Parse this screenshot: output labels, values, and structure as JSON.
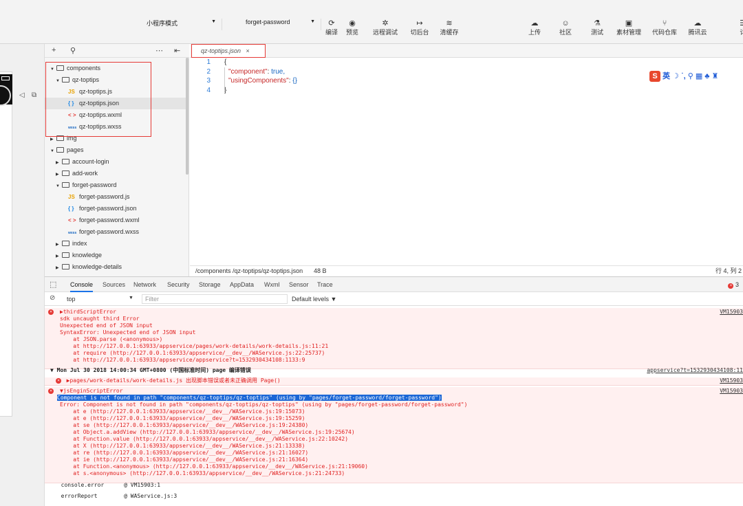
{
  "toolbar": {
    "mode_select": "小程序模式",
    "page_select": "forget-password",
    "buttons": [
      {
        "id": "compile",
        "icon": "refresh-icon",
        "glyph": "⟳",
        "label": "编译"
      },
      {
        "id": "preview",
        "icon": "eye-icon",
        "glyph": "◉",
        "label": "预览"
      },
      {
        "id": "remote-debug",
        "icon": "bug-icon",
        "glyph": "✲",
        "label": "远程调试"
      },
      {
        "id": "background",
        "icon": "switch-icon",
        "glyph": "↦",
        "label": "切后台"
      },
      {
        "id": "clear-cache",
        "icon": "layers-icon",
        "glyph": "≋",
        "label": "清缓存"
      },
      {
        "id": "upload",
        "icon": "cloud-upload-icon",
        "glyph": "☁",
        "label": "上传"
      },
      {
        "id": "community",
        "icon": "chat-icon",
        "glyph": "☺",
        "label": "社区"
      },
      {
        "id": "test",
        "icon": "flask-icon",
        "glyph": "⚗",
        "label": "测试"
      },
      {
        "id": "assets",
        "icon": "image-icon",
        "glyph": "▣",
        "label": "素材管理"
      },
      {
        "id": "repo",
        "icon": "branch-icon",
        "glyph": "⑂",
        "label": "代码仓库"
      },
      {
        "id": "tencent-cloud",
        "icon": "cloud-icon",
        "glyph": "☁",
        "label": "腾讯云"
      },
      {
        "id": "details",
        "icon": "menu-icon",
        "glyph": "☰",
        "label": "详"
      }
    ]
  },
  "tree": {
    "items": [
      {
        "label": "components",
        "type": "folder",
        "open": true,
        "level": 0
      },
      {
        "label": "qz-toptips",
        "type": "folder",
        "open": true,
        "level": 1
      },
      {
        "label": "qz-toptips.js",
        "type": "js",
        "level": 2
      },
      {
        "label": "qz-toptips.json",
        "type": "json",
        "level": 2,
        "selected": true
      },
      {
        "label": "qz-toptips.wxml",
        "type": "wxml",
        "level": 2
      },
      {
        "label": "qz-toptips.wxss",
        "type": "wxss",
        "level": 2
      },
      {
        "label": "img",
        "type": "folder",
        "open": false,
        "level": 0
      },
      {
        "label": "pages",
        "type": "folder",
        "open": true,
        "level": 0
      },
      {
        "label": "account-login",
        "type": "folder",
        "open": false,
        "level": 1
      },
      {
        "label": "add-work",
        "type": "folder",
        "open": false,
        "level": 1
      },
      {
        "label": "forget-password",
        "type": "folder",
        "open": true,
        "level": 1
      },
      {
        "label": "forget-password.js",
        "type": "js",
        "level": 2
      },
      {
        "label": "forget-password.json",
        "type": "json",
        "level": 2
      },
      {
        "label": "forget-password.wxml",
        "type": "wxml",
        "level": 2
      },
      {
        "label": "forget-password.wxss",
        "type": "wxss",
        "level": 2
      },
      {
        "label": "index",
        "type": "folder",
        "open": false,
        "level": 1
      },
      {
        "label": "knowledge",
        "type": "folder",
        "open": false,
        "level": 1
      },
      {
        "label": "knowledge-details",
        "type": "folder",
        "open": false,
        "level": 1
      }
    ],
    "icon_labels": {
      "js": "JS",
      "json": "{ }",
      "wxml": "< >",
      "wxss": "wxss"
    }
  },
  "editor": {
    "tab_label": "qz-toptips.json",
    "tab_close": "×",
    "lines": [
      {
        "n": "1",
        "text": "{"
      },
      {
        "n": "2",
        "key": "\"component\"",
        "val": " true,"
      },
      {
        "n": "3",
        "key": "\"usingComponents\"",
        "val": " {}"
      },
      {
        "n": "4",
        "text": "}"
      }
    ],
    "ime_text": "英 ☽ ˙, ⚲ ▦ ♣ ♜",
    "ime_logo": "S",
    "status_path": "/components /qz-toptips/qz-toptips.json",
    "status_size": "48 B",
    "status_pos": "行 4, 列 2"
  },
  "devtools": {
    "tabs": [
      "Console",
      "Sources",
      "Network",
      "Security",
      "Storage",
      "AppData",
      "Wxml",
      "Sensor",
      "Trace"
    ],
    "error_count": "3",
    "context": "top",
    "filter_placeholder": "Filter",
    "levels": "Default levels ▼",
    "lines": [
      {
        "t": "▶thirdScriptError",
        "cls": "e",
        "src": "VM15903"
      },
      {
        "t": "sdk uncaught third Error",
        "cls": "e"
      },
      {
        "t": "Unexpected end of JSON input",
        "cls": "e"
      },
      {
        "t": "SyntaxError: Unexpected end of JSON input",
        "cls": "e"
      },
      {
        "t": "    at JSON.parse (<anonymous>)",
        "cls": "e"
      },
      {
        "t": "    at http://127.0.0.1:63933/appservice/pages/work-details/work-details.js:11:21",
        "cls": "e"
      },
      {
        "t": "    at require (http://127.0.0.1:63933/appservice/__dev__/WAService.js:22:25737)",
        "cls": "e"
      },
      {
        "t": "    at http://127.0.0.1:63933/appservice/appservice?t=1532930434108:1133:9",
        "cls": "e"
      },
      {
        "t": "▼ Mon Jul 30 2018 14:00:34 GMT+0800 (中国标准时间) page 编译错误",
        "cls": "n",
        "src": "appservice?t=1532930434108:11"
      },
      {
        "t": "  ▶pages/work-details/work-details.js 出现脚本错误或者未正确调用 Page()",
        "cls": "e",
        "src": "VM15903"
      },
      {
        "t": "▼jsEnginScriptError",
        "cls": "e",
        "src": "VM15903"
      },
      {
        "t": "Component is not found in path \"components/qz-toptips/qz-toptips\" (using by \"pages/forget-password/forget-password\")",
        "cls": "s"
      },
      {
        "t": "Error: Component is not found in path \"components/qz-toptips/qz-toptips\" (using by \"pages/forget-password/forget-password\")",
        "cls": "e"
      },
      {
        "t": "    at e (http://127.0.0.1:63933/appservice/__dev__/WAService.js:19:15073)",
        "cls": "e"
      },
      {
        "t": "    at e (http://127.0.0.1:63933/appservice/__dev__/WAService.js:19:15259)",
        "cls": "e"
      },
      {
        "t": "    at se (http://127.0.0.1:63933/appservice/__dev__/WAService.js:19:24380)",
        "cls": "e"
      },
      {
        "t": "    at Object.a.addView (http://127.0.0.1:63933/appservice/__dev__/WAService.js:19:25674)",
        "cls": "e"
      },
      {
        "t": "    at Function.value (http://127.0.0.1:63933/appservice/__dev__/WAService.js:22:10242)",
        "cls": "e"
      },
      {
        "t": "    at X (http://127.0.0.1:63933/appservice/__dev__/WAService.js:21:13338)",
        "cls": "e"
      },
      {
        "t": "    at re (http://127.0.0.1:63933/appservice/__dev__/WAService.js:21:16027)",
        "cls": "e"
      },
      {
        "t": "    at ie (http://127.0.0.1:63933/appservice/__dev__/WAService.js:21:16364)",
        "cls": "e"
      },
      {
        "t": "    at Function.<anonymous> (http://127.0.0.1:63933/appservice/__dev__/WAService.js:21:19060)",
        "cls": "e"
      },
      {
        "t": "    at s.<anonymous> (http://127.0.0.1:63933/appservice/__dev__/WAService.js:21:24733)",
        "cls": "e"
      },
      {
        "t": "  console.error      @ VM15903:1",
        "cls": "n"
      },
      {
        "t": "  errorReport        @ WAService.js:3",
        "cls": "n"
      }
    ]
  }
}
